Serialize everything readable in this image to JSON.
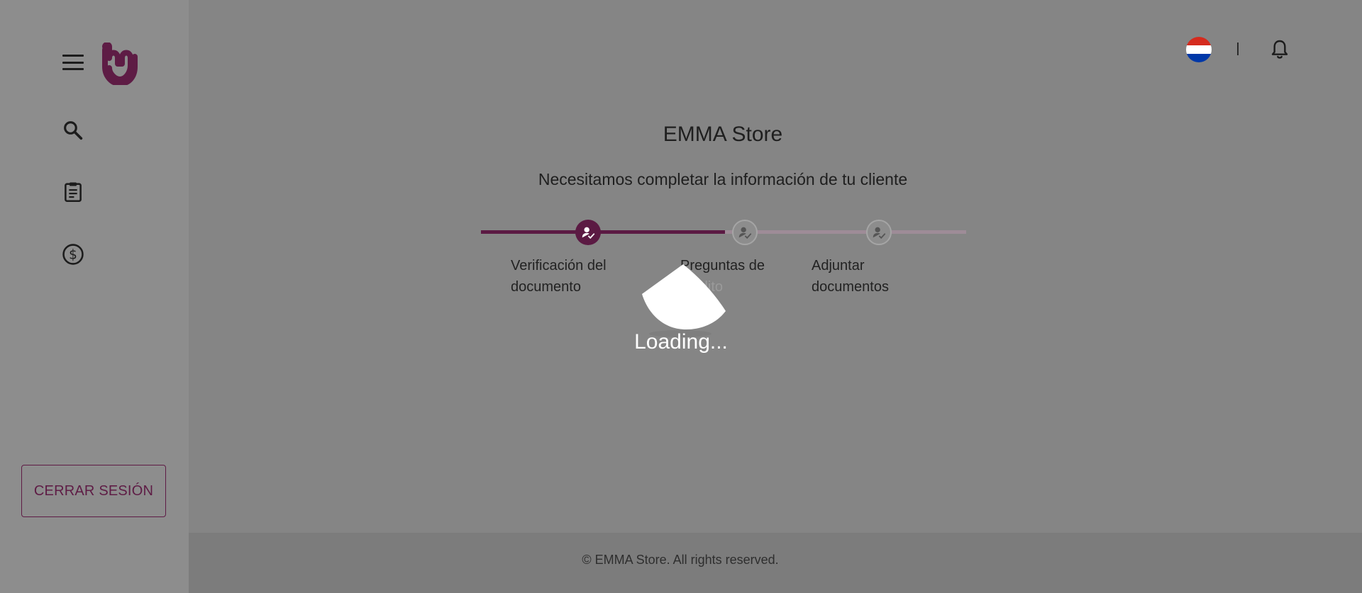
{
  "sidebar": {
    "logout_label": "CERRAR SESIÓN",
    "icons": [
      "menu-icon",
      "search-icon",
      "clipboard-icon",
      "dollar-icon"
    ],
    "brand_color": "#5e1c45"
  },
  "header": {
    "flag": "paraguay-flag",
    "notifications_icon": "bell-icon"
  },
  "main": {
    "title": "EMMA Store",
    "subtitle": "Necesitamos completar la información de tu cliente",
    "steps": [
      {
        "line1": "Verificación del",
        "line2": "documento",
        "status": "active"
      },
      {
        "line1": "Preguntas de",
        "line2": "crédito",
        "status": "pending"
      },
      {
        "line1": "Adjuntar",
        "line2": "documentos",
        "status": "pending"
      }
    ]
  },
  "overlay": {
    "loading_text": "Loading..."
  },
  "footer": {
    "text": "© EMMA Store. All rights reserved."
  },
  "colors": {
    "accent": "#5b1a43",
    "overlay_bg": "#858585",
    "pending_track": "#9e8c97"
  }
}
